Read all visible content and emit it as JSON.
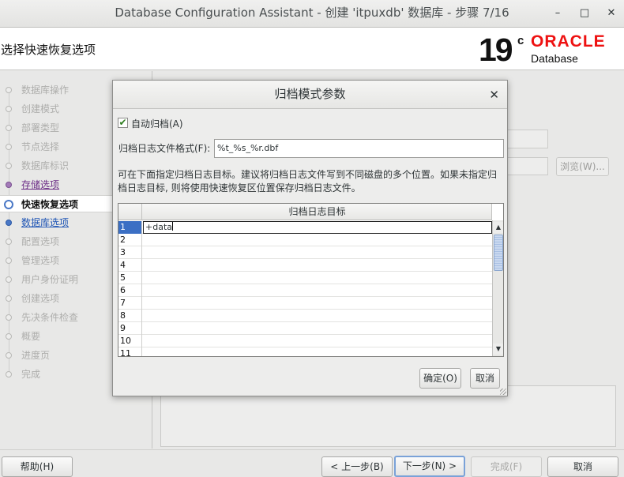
{
  "window": {
    "title": "Database Configuration Assistant - 创建 'itpuxdb' 数据库 - 步骤 7/16",
    "minimize": "–",
    "maximize": "□",
    "close": "✕"
  },
  "header": {
    "step_title": "选择快速恢复选项",
    "logo_version": "19",
    "logo_sup": "c",
    "logo_brand": "ORACLE",
    "logo_product": "Database"
  },
  "nav": {
    "items": [
      {
        "label": "数据库操作",
        "state": "disabled"
      },
      {
        "label": "创建模式",
        "state": "disabled"
      },
      {
        "label": "部署类型",
        "state": "disabled"
      },
      {
        "label": "节点选择",
        "state": "disabled"
      },
      {
        "label": "数据库标识",
        "state": "disabled"
      },
      {
        "label": "存储选项",
        "state": "done"
      },
      {
        "label": "快速恢复选项",
        "state": "active"
      },
      {
        "label": "数据库选项",
        "state": "link"
      },
      {
        "label": "配置选项",
        "state": "disabled"
      },
      {
        "label": "管理选项",
        "state": "disabled"
      },
      {
        "label": "用户身份证明",
        "state": "disabled"
      },
      {
        "label": "创建选项",
        "state": "disabled"
      },
      {
        "label": "先决条件检查",
        "state": "disabled"
      },
      {
        "label": "概要",
        "state": "disabled"
      },
      {
        "label": "进度页",
        "state": "disabled"
      },
      {
        "label": "完成",
        "state": "disabled"
      }
    ]
  },
  "background": {
    "browse_label": "浏览(W)..."
  },
  "dialog": {
    "title": "归档模式参数",
    "close": "✕",
    "auto_archive_label": "自动归档(A)",
    "auto_archive_checked": true,
    "check_mark": "✔",
    "format_label": "归档日志文件格式(F):",
    "format_value": "%t_%s_%r.dbf",
    "description": "可在下面指定归档日志目标。建议将归档日志文件写到不同磁盘的多个位置。如果未指定归档日志目标, 则将使用快速恢复区位置保存归档日志文件。",
    "grid": {
      "column_header": "归档日志目标",
      "rows": [
        {
          "num": "1",
          "value": "+data"
        },
        {
          "num": "2",
          "value": ""
        },
        {
          "num": "3",
          "value": ""
        },
        {
          "num": "4",
          "value": ""
        },
        {
          "num": "5",
          "value": ""
        },
        {
          "num": "6",
          "value": ""
        },
        {
          "num": "7",
          "value": ""
        },
        {
          "num": "8",
          "value": ""
        },
        {
          "num": "9",
          "value": ""
        },
        {
          "num": "10",
          "value": ""
        },
        {
          "num": "11",
          "value": ""
        }
      ]
    },
    "ok_label": "确定(O)",
    "cancel_label": "取消"
  },
  "buttons": {
    "help": "帮助(H)",
    "back": "< 上一步(B)",
    "next": "下一步(N) >",
    "finish": "完成(F)",
    "cancel": "取消"
  }
}
